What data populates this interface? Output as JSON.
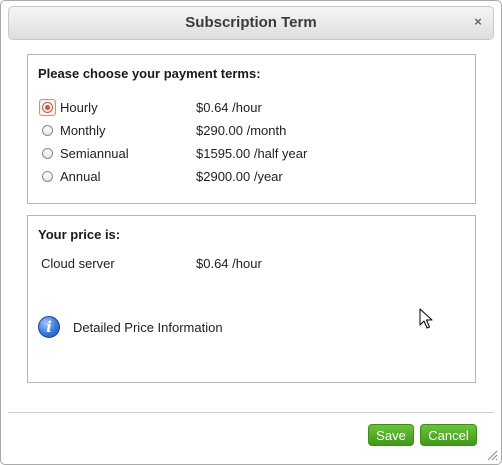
{
  "dialog": {
    "title": "Subscription Term",
    "close_glyph": "×"
  },
  "terms": {
    "heading": "Please choose your payment terms:",
    "selected": "Hourly",
    "options": [
      {
        "label": "Hourly",
        "price": "$0.64 /hour",
        "checked": true
      },
      {
        "label": "Monthly",
        "price": "$290.00 /month",
        "checked": false
      },
      {
        "label": "Semiannual",
        "price": "$1595.00 /half year",
        "checked": false
      },
      {
        "label": "Annual",
        "price": "$2900.00 /year",
        "checked": false
      }
    ]
  },
  "price": {
    "heading": "Your price is:",
    "item_name": "Cloud server",
    "item_price": "$0.64 /hour",
    "info_icon_glyph": "i",
    "info_link": "Detailed Price Information"
  },
  "buttons": {
    "save": "Save",
    "cancel": "Cancel"
  },
  "colors": {
    "button_green": "#4caf1e",
    "radio_selected": "#e0502c",
    "info_blue": "#3a78d8"
  },
  "icons": {
    "close": "close-icon",
    "info": "info-icon",
    "resize": "resize-grip-icon",
    "cursor": "mouse-pointer-icon"
  }
}
